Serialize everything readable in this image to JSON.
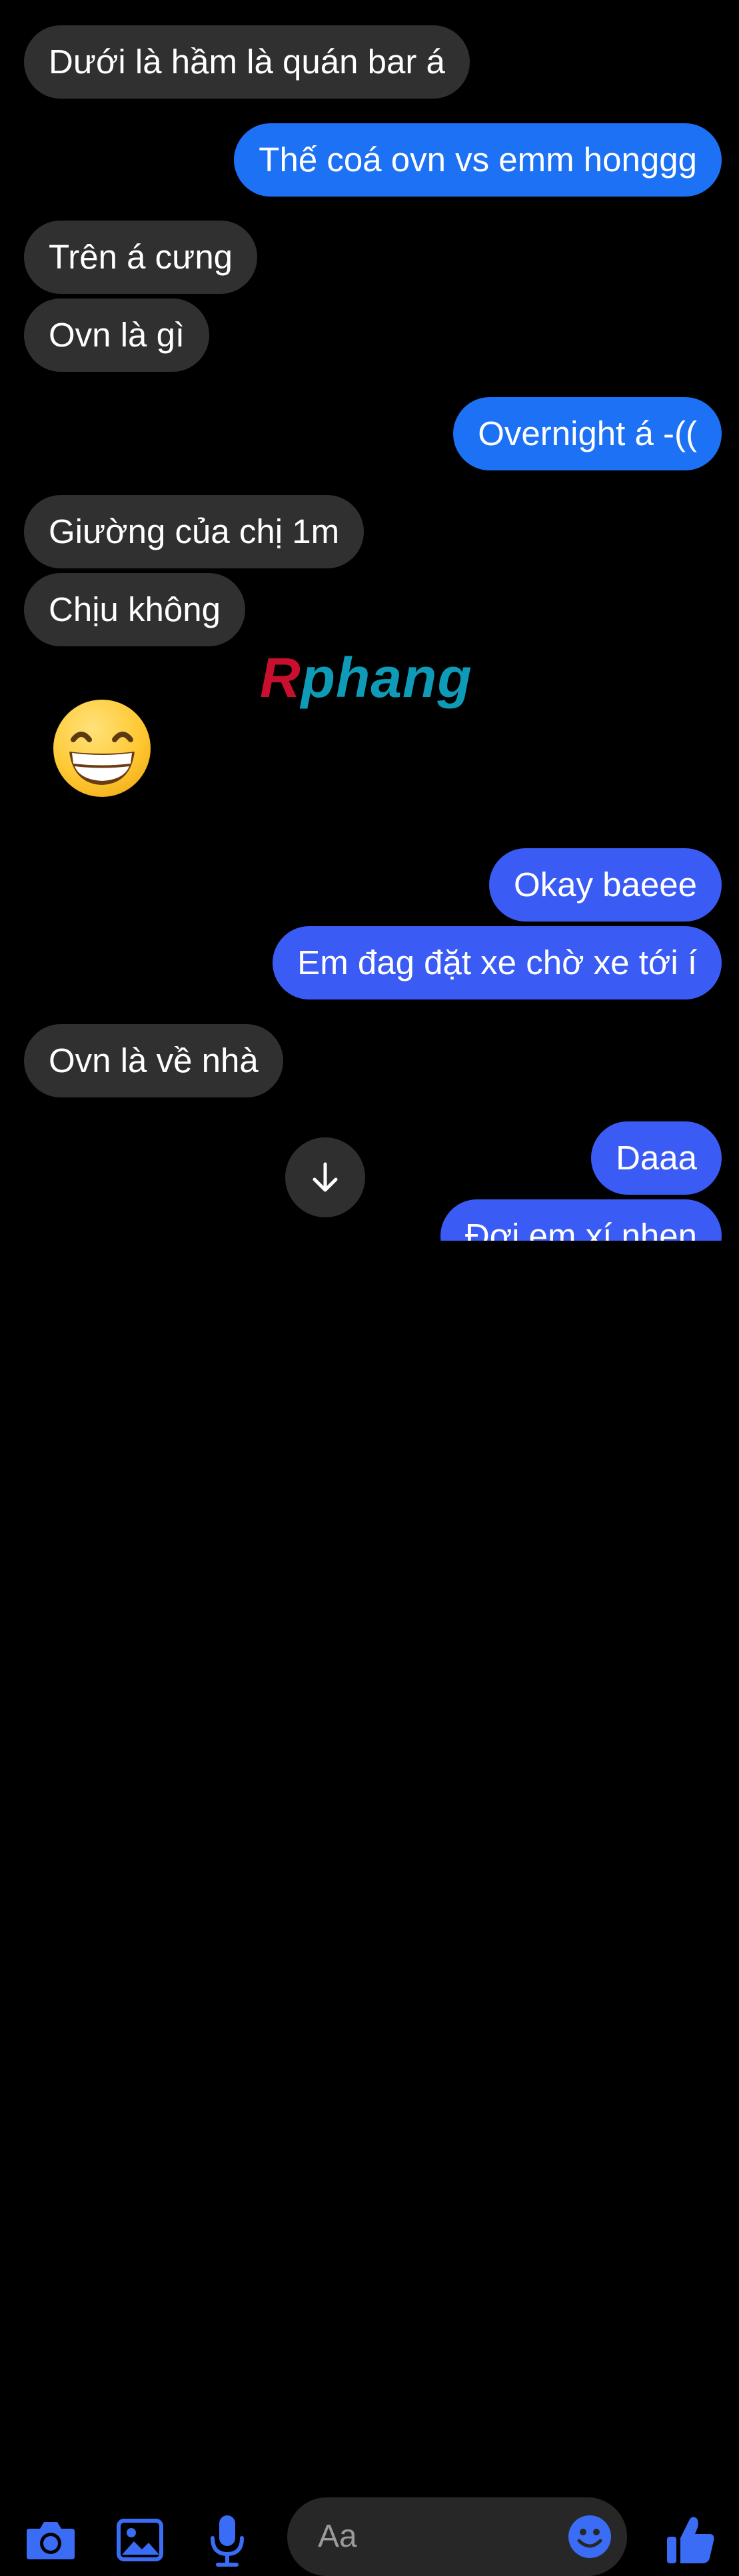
{
  "colors": {
    "background": "#000000",
    "received_bubble": "#303030",
    "sent_bubble_top": "#1c71f4",
    "sent_bubble_bottom": "#3a5cf5",
    "accent_icon": "#3b6cf6"
  },
  "messages": [
    {
      "side": "received",
      "text": "Dưới là hầm là quán bar á"
    },
    {
      "side": "sent",
      "text": "Thế coá ovn vs emm honggg"
    },
    {
      "side": "received",
      "text": "Trên á cưng"
    },
    {
      "side": "received",
      "text": "Ovn là gì"
    },
    {
      "side": "sent",
      "text": "Overnight á -(("
    },
    {
      "side": "received",
      "text": "Giường của chị 1m"
    },
    {
      "side": "received",
      "text": "Chịu không"
    },
    {
      "side": "received",
      "text": "😁",
      "type": "emoji"
    },
    {
      "side": "sent",
      "text": "Okay baeee"
    },
    {
      "side": "sent",
      "text": "Em đag đặt xe chờ xe tới í"
    },
    {
      "side": "received",
      "text": "Ovn là về nhà"
    },
    {
      "side": "sent",
      "text": "Daaa"
    },
    {
      "side": "sent",
      "text": "Đợi em xí nhen"
    }
  ],
  "watermark": {
    "part1": "R",
    "part2": "phang"
  },
  "composer": {
    "placeholder": "Aa",
    "icons": [
      "camera-icon",
      "photo-icon",
      "microphone-icon",
      "emoji-icon",
      "thumbs-up-icon"
    ]
  },
  "scroll_button_icon": "arrow-down-icon"
}
